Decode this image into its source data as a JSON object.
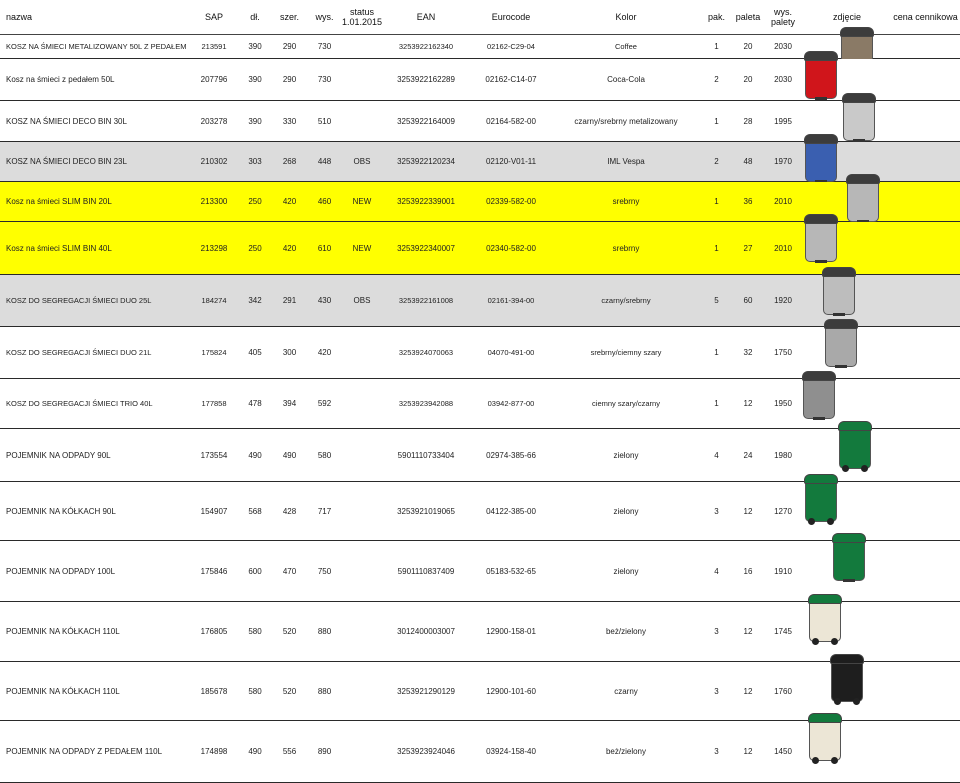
{
  "headers": {
    "nazwa": "nazwa",
    "sap": "SAP",
    "dl": "dł.",
    "szer": "szer.",
    "wys": "wys.",
    "status": "status 1.01.2015",
    "ean": "EAN",
    "eurocode": "Eurocode",
    "kolor": "Kolor",
    "pak": "pak.",
    "paleta": "paleta",
    "wys_palety": "wys. palety",
    "zdjecie": "zdjęcie",
    "cena": "cena cennikowa"
  },
  "rows": [
    {
      "nazwa": "KOSZ NA ŚMIECI METALIZOWANY  50L Z PEDAŁEM",
      "sap": "213591",
      "dl": "390",
      "szer": "290",
      "wys": "730",
      "status": "",
      "ean": "3253922162340",
      "eurocode": "02162-C29-04",
      "kolor": "Coffee",
      "pak": "1",
      "paleta": "20",
      "wys_palety": "2030",
      "photo": "coffee-pedal-bin-icon",
      "bin_color": "#8a7a66"
    },
    {
      "nazwa": "Kosz na śmieci z pedałem 50L",
      "sap": "207796",
      "dl": "390",
      "szer": "290",
      "wys": "730",
      "status": "",
      "ean": "3253922162289",
      "eurocode": "02162-C14-07",
      "kolor": "Coca-Cola",
      "pak": "2",
      "paleta": "20",
      "wys_palety": "2030",
      "photo": "coca-cola-pedal-bin-icon",
      "bin_color": "#d0151b"
    },
    {
      "nazwa": "KOSZ  NA ŚMIECI DECO BIN 30L",
      "sap": "203278",
      "dl": "390",
      "szer": "330",
      "wys": "510",
      "status": "",
      "ean": "3253922164009",
      "eurocode": "02164-582-00",
      "kolor": "czarny/srebrny metalizowany",
      "pak": "1",
      "paleta": "28",
      "wys_palety": "1995",
      "photo": "deco-bin-silver-icon",
      "bin_color": "#c9c9c9"
    },
    {
      "nazwa": "KOSZ  NA ŚMIECI DECO BIN 23L",
      "sap": "210302",
      "dl": "303",
      "szer": "268",
      "wys": "448",
      "status": "OBS",
      "ean": "3253922120234",
      "eurocode": "02120-V01-11",
      "kolor": "IML Vespa",
      "pak": "2",
      "paleta": "48",
      "wys_palety": "1970",
      "photo": "deco-bin-vespa-icon",
      "bin_color": "#3a5fb0"
    },
    {
      "nazwa": "Kosz na śmieci SLIM BIN 20L",
      "sap": "213300",
      "dl": "250",
      "szer": "420",
      "wys": "460",
      "status": "NEW",
      "ean": "3253922339001",
      "eurocode": "02339-582-00",
      "kolor": "srebrny",
      "pak": "1",
      "paleta": "36",
      "wys_palety": "2010",
      "photo": "slim-bin-20l-icon",
      "bin_color": "#b7b7b7"
    },
    {
      "nazwa": "Kosz na śmieci SLIM BIN 40L",
      "sap": "213298",
      "dl": "250",
      "szer": "420",
      "wys": "610",
      "status": "NEW",
      "ean": "3253922340007",
      "eurocode": "02340-582-00",
      "kolor": "srebrny",
      "pak": "1",
      "paleta": "27",
      "wys_palety": "2010",
      "photo": "slim-bin-40l-icon",
      "bin_color": "#b7b7b7"
    },
    {
      "nazwa": "KOSZ DO SEGREGACJI ŚMIECI  DUO  25L",
      "sap": "184274",
      "dl": "342",
      "szer": "291",
      "wys": "430",
      "status": "OBS",
      "ean": "3253922161008",
      "eurocode": "02161-394-00",
      "kolor": "czarny/srebrny",
      "pak": "5",
      "paleta": "60",
      "wys_palety": "1920",
      "photo": "duo-25l-bin-icon",
      "bin_color": "#bdbdbd"
    },
    {
      "nazwa": "KOSZ DO SEGREGACJI  ŚMIECI DUO 21L",
      "sap": "175824",
      "dl": "405",
      "szer": "300",
      "wys": "420",
      "status": "",
      "ean": "3253924070063",
      "eurocode": "04070-491-00",
      "kolor": "srebrny/ciemny szary",
      "pak": "1",
      "paleta": "32",
      "wys_palety": "1750",
      "photo": "duo-21l-bin-icon",
      "bin_color": "#a9a9a9"
    },
    {
      "nazwa": "KOSZ DO SEGREGACJI ŚMIECI TRIO 40L",
      "sap": "177858",
      "dl": "478",
      "szer": "394",
      "wys": "592",
      "status": "",
      "ean": "3253923942088",
      "eurocode": "03942-877-00",
      "kolor": "ciemny szary/czarny",
      "pak": "1",
      "paleta": "12",
      "wys_palety": "1950",
      "photo": "trio-40l-bin-icon",
      "bin_color": "#8f8f8f"
    },
    {
      "nazwa": "POJEMNIK NA ODPADY 90L",
      "sap": "173554",
      "dl": "490",
      "szer": "490",
      "wys": "580",
      "status": "",
      "ean": "5901110733404",
      "eurocode": "02974-385-66",
      "kolor": "zielony",
      "pak": "4",
      "paleta": "24",
      "wys_palety": "1980",
      "photo": "green-waste-container-90l-icon",
      "bin_color": "#137a3d"
    },
    {
      "nazwa": "POJEMNIK NA KÓŁKACH 90L",
      "sap": "154907",
      "dl": "568",
      "szer": "428",
      "wys": "717",
      "status": "",
      "ean": "3253921019065",
      "eurocode": "04122-385-00",
      "kolor": "zielony",
      "pak": "3",
      "paleta": "12",
      "wys_palety": "1270",
      "photo": "green-wheeled-bin-90l-icon",
      "bin_color": "#137a3d"
    },
    {
      "nazwa": "POJEMNIK NA ODPADY 100L",
      "sap": "175846",
      "dl": "600",
      "szer": "470",
      "wys": "750",
      "status": "",
      "ean": "5901110837409",
      "eurocode": "05183-532-65",
      "kolor": "zielony",
      "pak": "4",
      "paleta": "16",
      "wys_palety": "1910",
      "photo": "green-waste-container-100l-icon",
      "bin_color": "#137a3d"
    },
    {
      "nazwa": "POJEMNIK NA KÓŁKACH 110L",
      "sap": "176805",
      "dl": "580",
      "szer": "520",
      "wys": "880",
      "status": "",
      "ean": "3012400003007",
      "eurocode": "12900-158-01",
      "kolor": "beż/zielony",
      "pak": "3",
      "paleta": "12",
      "wys_palety": "1745",
      "photo": "beige-green-wheeled-bin-icon",
      "bin_color": "#ece6d6"
    },
    {
      "nazwa": "POJEMNIK NA KÓŁKACH 110L",
      "sap": "185678",
      "dl": "580",
      "szer": "520",
      "wys": "880",
      "status": "",
      "ean": "3253921290129",
      "eurocode": "12900-101-60",
      "kolor": "czarny",
      "pak": "3",
      "paleta": "12",
      "wys_palety": "1760",
      "photo": "black-wheeled-bin-icon",
      "bin_color": "#1e1e1e"
    },
    {
      "nazwa": "POJEMNIK NA ODPADY Z PEDAŁEM 110L",
      "sap": "174898",
      "dl": "490",
      "szer": "556",
      "wys": "890",
      "status": "",
      "ean": "3253923924046",
      "eurocode": "03924-158-40",
      "kolor": "beż/zielony",
      "pak": "3",
      "paleta": "12",
      "wys_palety": "1450",
      "photo": "beige-green-pedal-bin-icon",
      "bin_color": "#ece6d6"
    }
  ]
}
